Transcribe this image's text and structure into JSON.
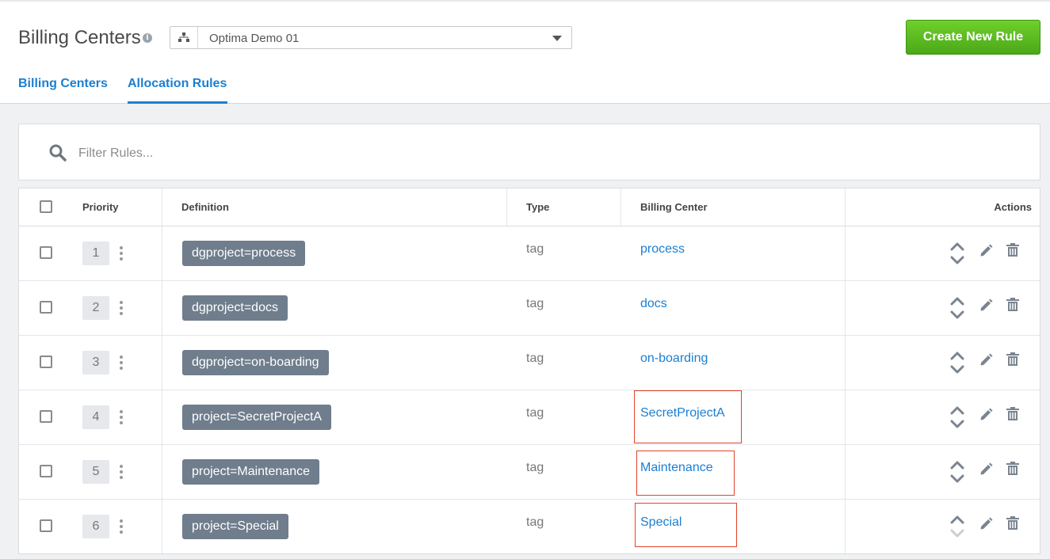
{
  "header": {
    "title": "Billing Centers",
    "org_selector": {
      "value": "Optima Demo 01"
    },
    "create_button_label": "Create New Rule",
    "tabs": [
      {
        "label": "Billing Centers",
        "active": false
      },
      {
        "label": "Allocation Rules",
        "active": true
      }
    ]
  },
  "filter": {
    "placeholder": "Filter Rules..."
  },
  "table": {
    "columns": {
      "priority": "Priority",
      "definition": "Definition",
      "type": "Type",
      "billing_center": "Billing Center",
      "actions": "Actions"
    },
    "rows": [
      {
        "priority": "1",
        "definition": "dgproject=process",
        "type": "tag",
        "billing_center": "process",
        "highlighted": false
      },
      {
        "priority": "2",
        "definition": "dgproject=docs",
        "type": "tag",
        "billing_center": "docs",
        "highlighted": false
      },
      {
        "priority": "3",
        "definition": "dgproject=on-boarding",
        "type": "tag",
        "billing_center": "on-boarding",
        "highlighted": false
      },
      {
        "priority": "4",
        "definition": "project=SecretProjectA",
        "type": "tag",
        "billing_center": "SecretProjectA",
        "highlighted": true
      },
      {
        "priority": "5",
        "definition": "project=Maintenance",
        "type": "tag",
        "billing_center": "Maintenance",
        "highlighted": true
      },
      {
        "priority": "6",
        "definition": "project=Special",
        "type": "tag",
        "billing_center": "Special",
        "highlighted": true
      }
    ]
  },
  "colors": {
    "accent": "#1b7fd1",
    "create_button": "#5cbf20",
    "tag_background": "#6f7d8c",
    "highlight_border": "#e2432a",
    "content_background": "#f0f1f3"
  },
  "icons": [
    "info-icon",
    "org-hierarchy-icon",
    "chevron-down-icon",
    "search-icon",
    "drag-handle-icon",
    "move-up-icon",
    "move-down-icon",
    "edit-pencil-icon",
    "trash-icon"
  ]
}
